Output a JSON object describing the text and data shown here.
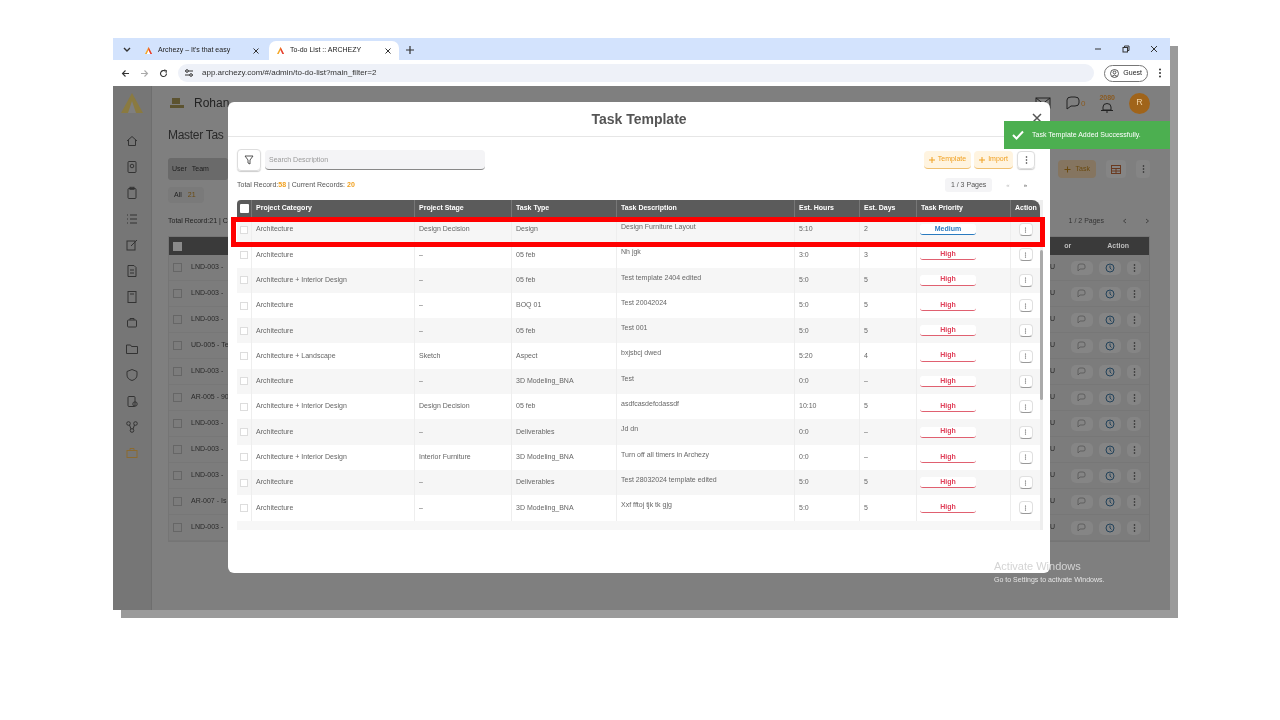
{
  "browser": {
    "tabs": [
      {
        "title": "Archezy – It's that easy",
        "selected": false
      },
      {
        "title": "To-do List :: ARCHEZY",
        "selected": true
      }
    ],
    "url": "app.archezy.com/#/admin/to-do-list?main_filter=2",
    "profile": "Guest"
  },
  "app": {
    "company": "Rohan",
    "page_title": "Master Tas",
    "toggle": [
      "User",
      "Team"
    ],
    "chip": {
      "label": "All",
      "count": "21"
    },
    "total": "Total Record:21 | C",
    "add_button": "Task",
    "pages": "1 / 2 Pages",
    "header_cells": [
      "or",
      "Action"
    ],
    "chat_count": "0",
    "notif_count": "2080",
    "avatar": "R",
    "select_all_checked": false,
    "rows": [
      {
        "code": "LND-003 -",
        "user": "U",
        "checked": false
      },
      {
        "code": "LND-003 -",
        "user": "U",
        "checked": false
      },
      {
        "code": "LND-003 -",
        "user": "U",
        "checked": false
      },
      {
        "code": "UD-005 - Te",
        "user": "U",
        "checked": false
      },
      {
        "code": "LND-003 -",
        "user": "U",
        "checked": false
      },
      {
        "code": "AR-005 - 90",
        "user": "U",
        "checked": false
      },
      {
        "code": "LND-003 -",
        "user": "U",
        "checked": false
      },
      {
        "code": "LND-003 -",
        "user": "U",
        "checked": false
      },
      {
        "code": "LND-003 -",
        "user": "U",
        "checked": false
      },
      {
        "code": "AR-007 - Is",
        "user": "U",
        "checked": false
      },
      {
        "code": "LND-003 -",
        "user": "U",
        "checked": false
      }
    ]
  },
  "modal": {
    "title": "Task Template",
    "search": {
      "placeholder": "Search Description"
    },
    "buttons": [
      "Template",
      "Import"
    ],
    "select_all_checked": false,
    "total_label": "Total Record:",
    "total": "58",
    "current_label": "| Current Records:",
    "current": "20",
    "pages": "1 / 3 Pages",
    "prev": "«",
    "next": "»",
    "columns": [
      "Project Category",
      "Project Stage",
      "Task Type",
      "Task Description",
      "Est. Hours",
      "Est. Days",
      "Task Priority",
      "Action"
    ],
    "rows": [
      {
        "category": "Architecture",
        "stage": "Design Decision",
        "type": "Design",
        "description": "Design Furniture Layout",
        "hours": "5:10",
        "days": "2",
        "priority": "Medium",
        "kind": "medium",
        "highlighted": true,
        "checked": false
      },
      {
        "category": "Architecture",
        "stage": "–",
        "type": "05 feb",
        "description": "Nh jgk",
        "hours": "3:0",
        "days": "3",
        "priority": "High",
        "kind": "high",
        "highlighted": false,
        "checked": false
      },
      {
        "category": "Architecture + Interior Design",
        "stage": "–",
        "type": "05 feb",
        "description": "Test template 2404 edited",
        "hours": "5:0",
        "days": "5",
        "priority": "High",
        "kind": "high",
        "highlighted": false,
        "checked": false
      },
      {
        "category": "Architecture",
        "stage": "–",
        "type": "BOQ 01",
        "description": "Test 20042024",
        "hours": "5:0",
        "days": "5",
        "priority": "High",
        "kind": "high",
        "highlighted": false,
        "checked": false
      },
      {
        "category": "Architecture",
        "stage": "–",
        "type": "05 feb",
        "description": "Test 001",
        "hours": "5:0",
        "days": "5",
        "priority": "High",
        "kind": "high",
        "highlighted": false,
        "checked": false
      },
      {
        "category": "Architecture + Landscape",
        "stage": "Sketch",
        "type": "Aspect",
        "description": "bxjsbcj dwed",
        "hours": "5:20",
        "days": "4",
        "priority": "High",
        "kind": "high",
        "highlighted": false,
        "checked": false
      },
      {
        "category": "Architecture",
        "stage": "–",
        "type": "3D Modeling_BNA",
        "description": "Test",
        "hours": "0:0",
        "days": "–",
        "priority": "High",
        "kind": "high",
        "highlighted": false,
        "checked": false
      },
      {
        "category": "Architecture + Interior Design",
        "stage": "Design Decision",
        "type": "05 feb",
        "description": "asdfcasdefcdassdf",
        "hours": "10:10",
        "days": "5",
        "priority": "High",
        "kind": "high",
        "highlighted": false,
        "checked": false
      },
      {
        "category": "Architecture",
        "stage": "–",
        "type": "Deliverables",
        "description": "Jd dn",
        "hours": "0:0",
        "days": "–",
        "priority": "High",
        "kind": "high",
        "highlighted": false,
        "checked": false
      },
      {
        "category": "Architecture + Interior Design",
        "stage": "Interior Furniture",
        "type": "3D Modeling_BNA",
        "description": "Turn off all timers in Archezy",
        "hours": "0:0",
        "days": "–",
        "priority": "High",
        "kind": "high",
        "highlighted": false,
        "checked": false
      },
      {
        "category": "Architecture",
        "stage": "–",
        "type": "Deliverables",
        "description": "Test 28032024 template edited",
        "hours": "5:0",
        "days": "5",
        "priority": "High",
        "kind": "high",
        "highlighted": false,
        "checked": false
      },
      {
        "category": "Architecture",
        "stage": "–",
        "type": "3D Modeling_BNA",
        "description": "Xxf fftoj tjk tk gjg",
        "hours": "5:0",
        "days": "5",
        "priority": "High",
        "kind": "high",
        "highlighted": false,
        "checked": false
      }
    ]
  },
  "toast": "Task Template Added Successfully.",
  "os_notice": {
    "title": "Activate Windows",
    "text": "Go to Settings to activate Windows."
  }
}
